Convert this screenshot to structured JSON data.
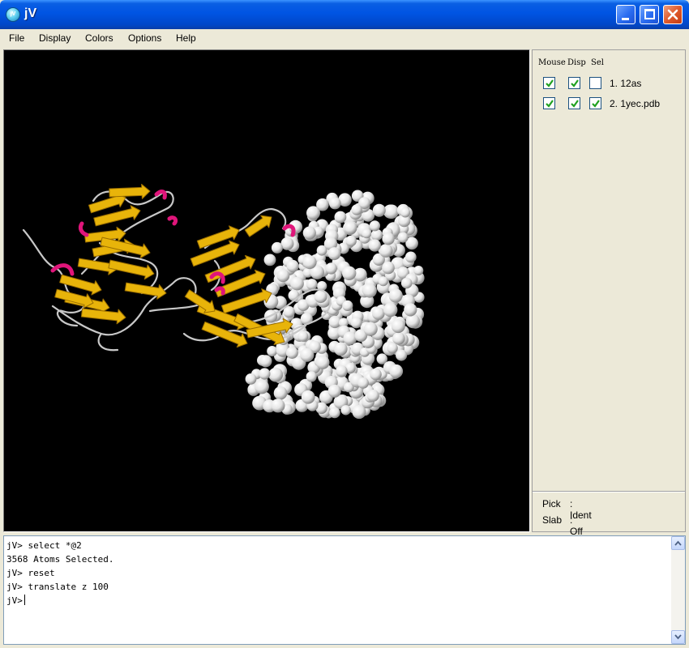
{
  "window": {
    "title": "jV",
    "icon": "jv-app-icon",
    "icon_text": "jV",
    "controls": [
      "minimize-icon",
      "maximize-icon",
      "close-icon"
    ]
  },
  "menu": {
    "items": [
      "File",
      "Display",
      "Colors",
      "Options",
      "Help"
    ]
  },
  "panel": {
    "headers": {
      "mouse": "Mouse",
      "disp": "Disp",
      "sel": "Sel"
    },
    "molecules": [
      {
        "label": "1. 12as",
        "mouse": true,
        "disp": true,
        "sel": false
      },
      {
        "label": "2. 1yec.pdb",
        "mouse": true,
        "disp": true,
        "sel": true
      }
    ],
    "status": [
      {
        "key": "Pick",
        "value": ": Ident"
      },
      {
        "key": "Slab",
        "value": ": Off"
      }
    ]
  },
  "console": {
    "lines": [
      "jV> select *@2",
      "3568 Atoms Selected.",
      "jV> reset",
      "jV> translate z 100",
      "jV>"
    ]
  },
  "colors": {
    "viewer_bg": "#000000",
    "ribbon_strand": "#e8b40a",
    "ribbon_helix": "#e0157a",
    "coil": "#d8d8d8",
    "spacefill": "#f2f2f2",
    "check_mark": "#21a121",
    "titlebar": "#0054e3"
  }
}
